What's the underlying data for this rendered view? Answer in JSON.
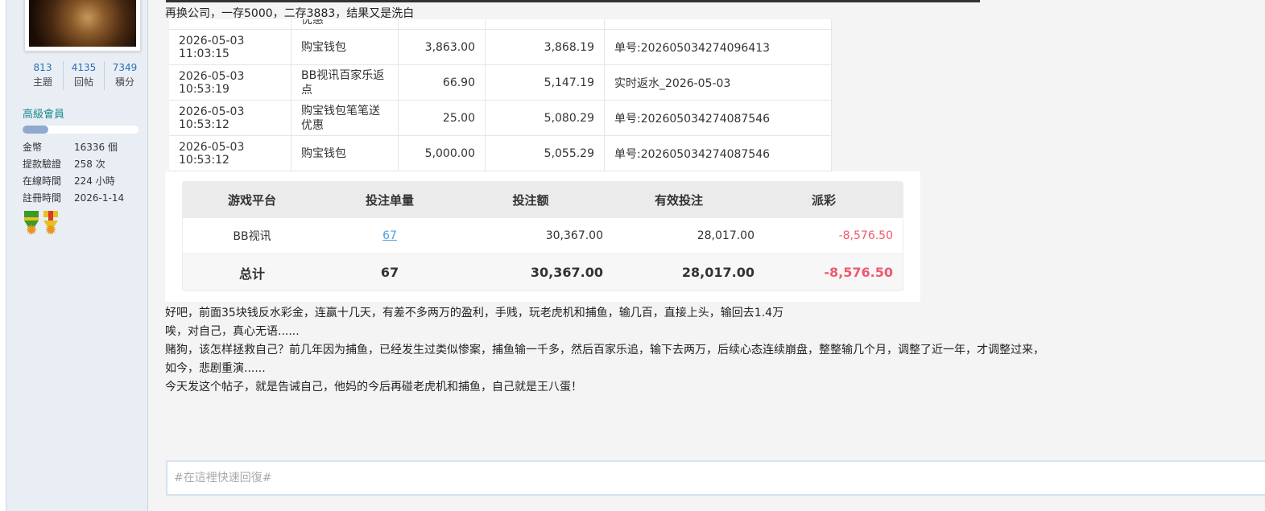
{
  "sidebar": {
    "stats": [
      {
        "num": "813",
        "label": "主題"
      },
      {
        "num": "4135",
        "label": "回帖"
      },
      {
        "num": "7349",
        "label": "積分"
      }
    ],
    "level": "高級會員",
    "level_progress": 0.22,
    "info": [
      {
        "key": "金幣",
        "value": "16336 個"
      },
      {
        "key": "提款驗證",
        "value": "258 次"
      },
      {
        "key": "在線時間",
        "value": "224 小時"
      },
      {
        "key": "註冊時間",
        "value": "2026-1-14"
      }
    ],
    "medals": [
      "medal-icon",
      "medal-icon"
    ]
  },
  "post": {
    "line1": "再换公司，一存5000，二存3883，结果又是洗白",
    "records": [
      {
        "time": "",
        "type": "优惠",
        "amount": "",
        "balance": "",
        "note": ""
      },
      {
        "time": "2026-05-03 11:03:15",
        "type": "购宝钱包",
        "amount": "3,863.00",
        "balance": "3,868.19",
        "note": "单号:202605034274096413"
      },
      {
        "time": "2026-05-03 10:53:19",
        "type": "BB视讯百家乐返点",
        "amount": "66.90",
        "balance": "5,147.19",
        "note": "实时返水_2026-05-03"
      },
      {
        "time": "2026-05-03 10:53:12",
        "type": "购宝钱包笔笔送优惠",
        "amount": "25.00",
        "balance": "5,080.29",
        "note": "单号:202605034274087546"
      },
      {
        "time": "2026-05-03 10:53:12",
        "type": "购宝钱包",
        "amount": "5,000.00",
        "balance": "5,055.29",
        "note": "单号:202605034274087546"
      }
    ],
    "summary": {
      "headers": [
        "游戏平台",
        "投注单量",
        "投注额",
        "有效投注",
        "派彩"
      ],
      "row": {
        "platform": "BB视讯",
        "count": "67",
        "bet": "30,367.00",
        "valid": "28,017.00",
        "payout": "-8,576.50"
      },
      "total": {
        "label": "总计",
        "count": "67",
        "bet": "30,367.00",
        "valid": "28,017.00",
        "payout": "-8,576.50"
      }
    },
    "paragraphs": [
      "好吧，前面35块钱反水彩金，连赢十几天，有差不多两万的盈利，手贱，玩老虎机和捕鱼，输几百，直接上头，输回去1.4万",
      "唉，对自己，真心无语......",
      "赌狗，该怎样拯救自己？前几年因为捕鱼，已经发生过类似惨案，捕鱼输一千多，然后百家乐追，输下去两万，后续心态连续崩盘，整整输几个月，调整了近一年，才调整过来，",
      "如今，悲剧重演......",
      "今天发这个帖子，就是告诫自己，他妈的今后再碰老虎机和捕鱼，自己就是王八蛋！"
    ]
  },
  "reply": {
    "placeholder": "#在這裡快速回復#"
  }
}
